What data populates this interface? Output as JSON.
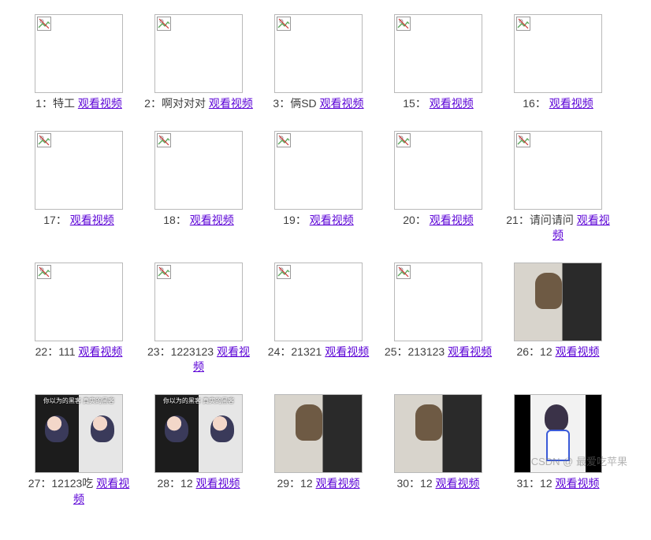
{
  "link_label": "观看视频",
  "watermark": "CSDN @ 最爱吃苹果",
  "items": [
    {
      "id": "1",
      "title": "特工",
      "thumb": "broken"
    },
    {
      "id": "2",
      "title": "啊对对对",
      "thumb": "broken"
    },
    {
      "id": "3",
      "title": "俩SD",
      "thumb": "broken"
    },
    {
      "id": "15",
      "title": "",
      "thumb": "broken"
    },
    {
      "id": "16",
      "title": "",
      "thumb": "broken"
    },
    {
      "id": "17",
      "title": "",
      "thumb": "broken"
    },
    {
      "id": "18",
      "title": "",
      "thumb": "broken"
    },
    {
      "id": "19",
      "title": "",
      "thumb": "broken"
    },
    {
      "id": "20",
      "title": "",
      "thumb": "broken"
    },
    {
      "id": "21",
      "title": "请问请问",
      "thumb": "broken"
    },
    {
      "id": "22",
      "title": "111",
      "thumb": "broken"
    },
    {
      "id": "23",
      "title": "1223123",
      "thumb": "broken"
    },
    {
      "id": "24",
      "title": "21321",
      "thumb": "broken"
    },
    {
      "id": "25",
      "title": "213123",
      "thumb": "broken"
    },
    {
      "id": "26",
      "title": "12",
      "thumb": "person"
    },
    {
      "id": "27",
      "title": "12123吃",
      "thumb": "anime"
    },
    {
      "id": "28",
      "title": "12",
      "thumb": "anime"
    },
    {
      "id": "29",
      "title": "12",
      "thumb": "person"
    },
    {
      "id": "30",
      "title": "12",
      "thumb": "person"
    },
    {
      "id": "31",
      "title": "12",
      "thumb": "girl"
    }
  ]
}
